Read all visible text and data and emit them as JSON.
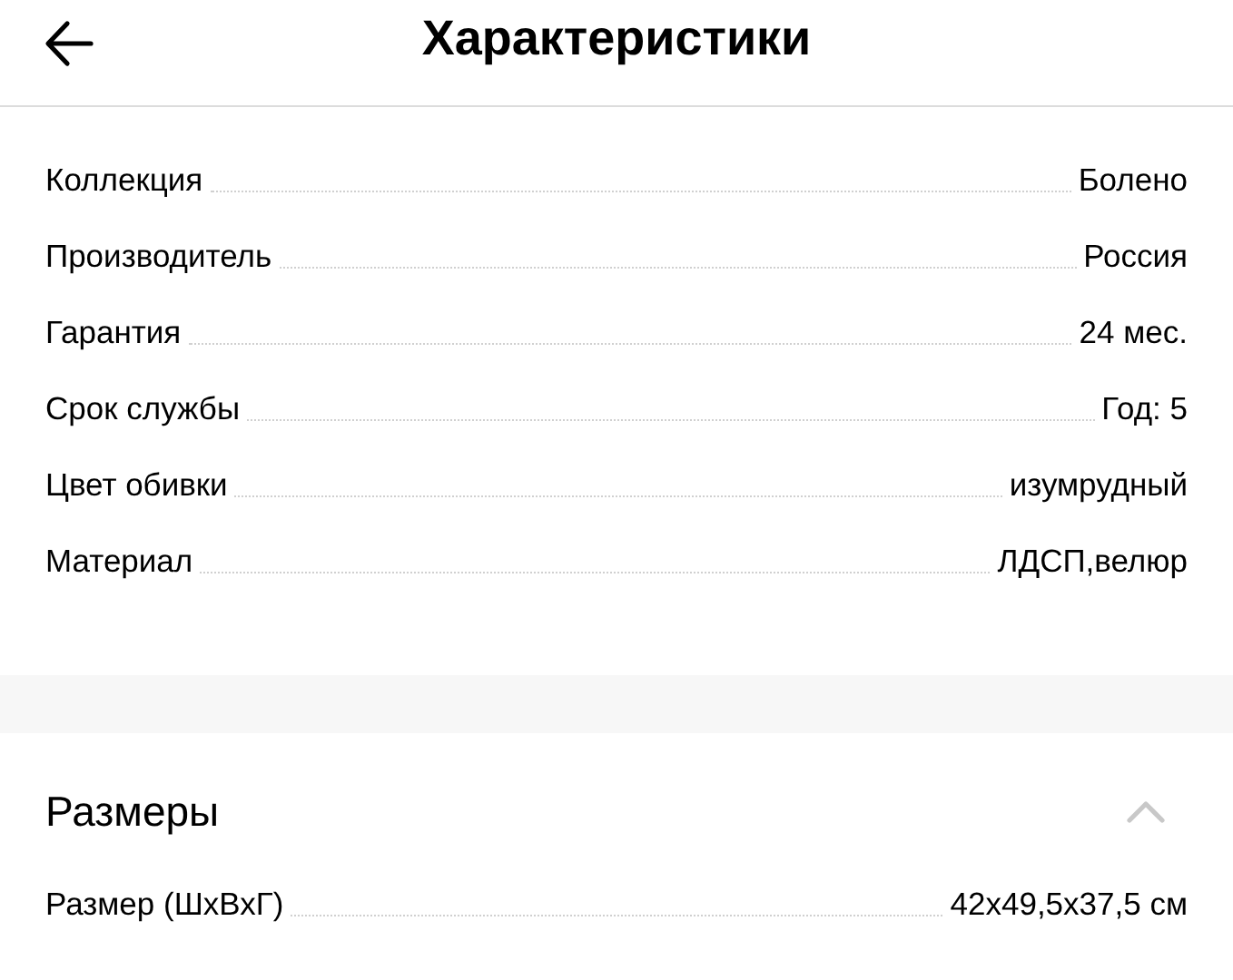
{
  "header": {
    "title": "Характеристики"
  },
  "specs": [
    {
      "label": "Коллекция",
      "value": "Болено"
    },
    {
      "label": "Производитель",
      "value": "Россия"
    },
    {
      "label": "Гарантия",
      "value": "24 мес."
    },
    {
      "label": "Срок службы",
      "value": "Год: 5"
    },
    {
      "label": "Цвет обивки",
      "value": "изумрудный"
    },
    {
      "label": "Материал",
      "value": "ЛДСП,велюр"
    }
  ],
  "sections": [
    {
      "title": "Размеры",
      "expanded": true,
      "rows": [
        {
          "label": "Размер (ШхВхГ)",
          "value": "42x49,5x37,5 см"
        }
      ]
    }
  ]
}
